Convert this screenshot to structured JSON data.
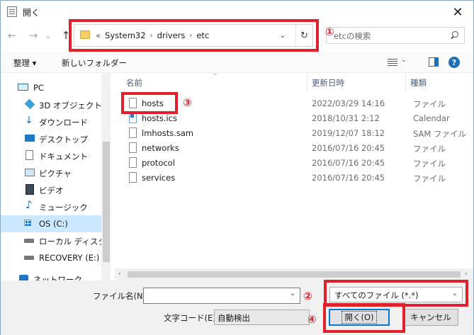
{
  "window": {
    "title": "開く",
    "close_glyph": "✕"
  },
  "nav": {
    "back_glyph": "←",
    "forward_glyph": "→",
    "history_glyph": "⌄",
    "up_glyph": "↑"
  },
  "address": {
    "overflow": "«",
    "crumbs": [
      "System32",
      "drivers",
      "etc"
    ],
    "separator": "›",
    "dropdown_glyph": "⌄",
    "refresh_glyph": "↻"
  },
  "search": {
    "placeholder": "etcの検索"
  },
  "toolbar": {
    "organize_label": "整理 ▾",
    "new_folder_label": "新しいフォルダー",
    "help_glyph": "?"
  },
  "sidebar": {
    "items": [
      {
        "label": "PC",
        "icon": "pc-icon"
      },
      {
        "label": "3D オブジェクト",
        "icon": "cube-icon"
      },
      {
        "label": "ダウンロード",
        "icon": "download-icon"
      },
      {
        "label": "デスクトップ",
        "icon": "desktop-icon"
      },
      {
        "label": "ドキュメント",
        "icon": "document-icon"
      },
      {
        "label": "ピクチャ",
        "icon": "picture-icon"
      },
      {
        "label": "ビデオ",
        "icon": "video-icon"
      },
      {
        "label": "ミュージック",
        "icon": "music-icon"
      },
      {
        "label": "OS (C:)",
        "icon": "windows-drive-icon"
      },
      {
        "label": "ローカル ディスク (D",
        "icon": "drive-icon"
      },
      {
        "label": "RECOVERY (E:)",
        "icon": "drive-icon"
      },
      {
        "label": "ネットワーク",
        "icon": "network-icon"
      }
    ],
    "selected_index": 8
  },
  "filelist": {
    "columns": {
      "name": "名前",
      "date": "更新日時",
      "type": "種類"
    },
    "sort_glyph": "^",
    "rows": [
      {
        "name": "hosts",
        "date": "2022/03/29 14:16",
        "type": "ファイル",
        "icon": "file-icon"
      },
      {
        "name": "hosts.ics",
        "date": "2018/10/31 2:12",
        "type": "Calendar",
        "icon": "calendar-file-icon"
      },
      {
        "name": "lmhosts.sam",
        "date": "2019/12/07 18:12",
        "type": "SAM ファイル",
        "icon": "file-icon"
      },
      {
        "name": "networks",
        "date": "2016/07/16 20:45",
        "type": "ファイル",
        "icon": "file-icon"
      },
      {
        "name": "protocol",
        "date": "2016/07/16 20:45",
        "type": "ファイル",
        "icon": "file-icon"
      },
      {
        "name": "services",
        "date": "2016/07/16 20:45",
        "type": "ファイル",
        "icon": "file-icon"
      }
    ],
    "scroll_left_glyph": "‹",
    "scroll_right_glyph": "›"
  },
  "bottom": {
    "filename_label": "ファイル名(N):",
    "filename_value": "",
    "filename_dd_glyph": "⌄",
    "filter_value": "すべてのファイル (*.*)",
    "filter_dd_glyph": "⌄",
    "encoding_label": "文字コード(E):",
    "encoding_value": "自動検出",
    "open_label": "開く(O)",
    "cancel_label": "キャンセル"
  },
  "annotations": {
    "a1": "①",
    "a2": "②",
    "a3": "③",
    "a4": "④"
  },
  "colors": {
    "annotation_red": "#e0202a",
    "selection": "#cce8ff",
    "accent": "#0078d7"
  }
}
